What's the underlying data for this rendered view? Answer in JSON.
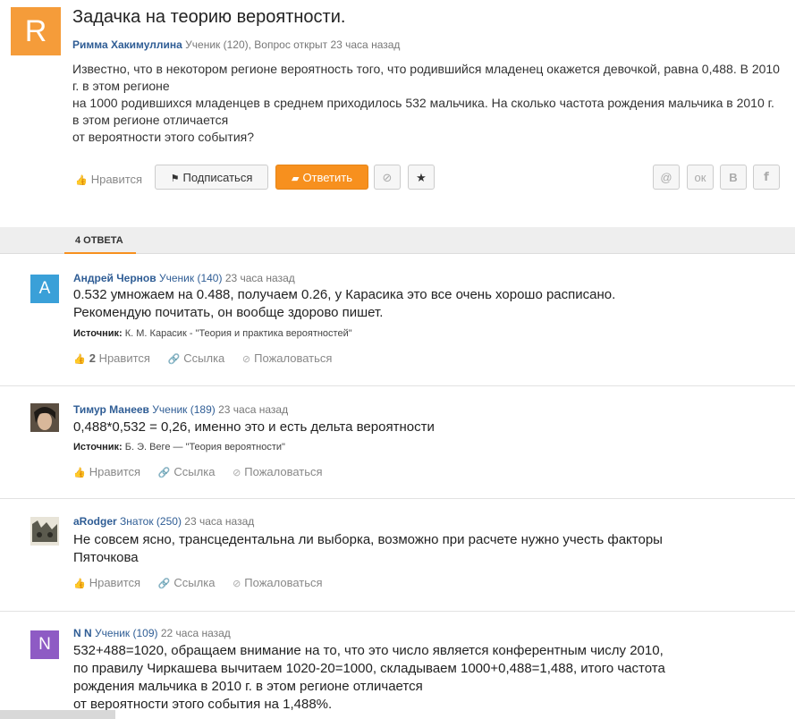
{
  "question": {
    "avatar_letter": "R",
    "title": "Задачка на теорию вероятности.",
    "author": "Римма Хакимуллина",
    "meta": " Ученик (120), Вопрос открыт 23 часа назад",
    "body": [
      "Известно, что в некотором регионе вероятность того, что родившийся младенец окажется девочкой, равна 0,488. В 2010 г. в этом регионе",
      "на 1000 родившихся младенцев в среднем приходилось 532 мальчика. На сколько частота рождения мальчика в 2010 г. в этом регионе отличается",
      "от вероятности этого события?"
    ],
    "actions": {
      "like_label": "Нравится",
      "subscribe_label": "Подписаться",
      "answer_label": "Ответить",
      "mail_glyph": "@",
      "ok_glyph": "ок",
      "vk_glyph": "В",
      "fb_glyph": "f"
    }
  },
  "tabs": {
    "answers_count_label": "4 ОТВЕТА"
  },
  "answers": [
    {
      "avatar_letter": "A",
      "avatar_color": "#3aa0d8",
      "author": "Андрей Чернов",
      "rank": "Ученик (140)",
      "time": "23 часа назад",
      "text": [
        "0.532 умножаем на 0.488, получаем 0.26, у Карасика это все очень хорошо расписано.",
        "Рекомендую почитать, он вообще здорово пишет."
      ],
      "source_label": "Источник:",
      "source": "К. М. Карасик - \"Теория и практика вероятностей\"",
      "likes": "2",
      "like_label": "Нравится",
      "link_label": "Ссылка",
      "report_label": "Пожаловаться"
    },
    {
      "author": "Тимур Манеев",
      "rank": "Ученик (189)",
      "time": "23 часа назад",
      "text": [
        "0,488*0,532 = 0,26, именно это и есть дельта вероятности"
      ],
      "source_label": "Источник:",
      "source": "Б. Э. Веге — \"Теория вероятности\"",
      "like_label": "Нравится",
      "link_label": "Ссылка",
      "report_label": "Пожаловаться"
    },
    {
      "author": "aRodger",
      "rank": "Знаток (250)",
      "time": "23 часа назад",
      "text": [
        "Не совсем ясно, трансцедентальна ли выборка, возможно при расчете нужно учесть факторы",
        "Пяточкова"
      ],
      "like_label": "Нравится",
      "link_label": "Ссылка",
      "report_label": "Пожаловаться"
    },
    {
      "avatar_letter": "N",
      "avatar_color": "#8e5bc4",
      "author": "N N",
      "rank": "Ученик (109)",
      "time": "22 часа назад",
      "text": [
        "532+488=1020, обращаем внимание на то, что это число является конферентным числу 2010,",
        "по правилу Чиркашева вычитаем 1020-20=1000, складываем 1000+0,488=1,488, итого частота",
        "рождения мальчика в 2010 г. в этом регионе отличается",
        "от вероятности этого события на 1,488%."
      ]
    }
  ],
  "colors": {
    "accent": "#f7901e",
    "link": "#2f5d95",
    "question_avatar": "#f59c3a"
  }
}
